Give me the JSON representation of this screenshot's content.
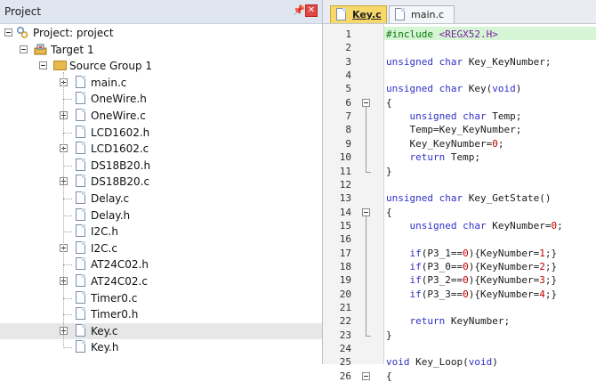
{
  "panel": {
    "title": "Project"
  },
  "tree": [
    {
      "label": "Project: project",
      "type": "project",
      "expander": "minus"
    },
    {
      "label": "Target 1",
      "type": "target",
      "expander": "minus"
    },
    {
      "label": "Source Group 1",
      "type": "folder",
      "expander": "minus"
    },
    {
      "label": "main.c",
      "type": "file",
      "expander": "plus"
    },
    {
      "label": "OneWire.h",
      "type": "file",
      "expander": ""
    },
    {
      "label": "OneWire.c",
      "type": "file",
      "expander": "plus"
    },
    {
      "label": "LCD1602.h",
      "type": "file",
      "expander": ""
    },
    {
      "label": "LCD1602.c",
      "type": "file",
      "expander": "plus"
    },
    {
      "label": "DS18B20.h",
      "type": "file",
      "expander": ""
    },
    {
      "label": "DS18B20.c",
      "type": "file",
      "expander": "plus"
    },
    {
      "label": "Delay.c",
      "type": "file",
      "expander": ""
    },
    {
      "label": "Delay.h",
      "type": "file",
      "expander": ""
    },
    {
      "label": "I2C.h",
      "type": "file",
      "expander": ""
    },
    {
      "label": "I2C.c",
      "type": "file",
      "expander": "plus"
    },
    {
      "label": "AT24C02.h",
      "type": "file",
      "expander": ""
    },
    {
      "label": "AT24C02.c",
      "type": "file",
      "expander": "plus"
    },
    {
      "label": "Timer0.c",
      "type": "file",
      "expander": ""
    },
    {
      "label": "Timer0.h",
      "type": "file",
      "expander": ""
    },
    {
      "label": "Key.c",
      "type": "file",
      "expander": "plus",
      "selected": true
    },
    {
      "label": "Key.h",
      "type": "file",
      "expander": ""
    }
  ],
  "tabs": [
    {
      "label": "Key.c",
      "active": true
    },
    {
      "label": "main.c",
      "active": false
    }
  ],
  "code": [
    {
      "n": "1",
      "text": "#include <REGX52.H>",
      "highlight": true
    },
    {
      "n": "2",
      "text": ""
    },
    {
      "n": "3",
      "text": "unsigned char Key_KeyNumber;"
    },
    {
      "n": "4",
      "text": ""
    },
    {
      "n": "5",
      "text": "unsigned char Key(void)"
    },
    {
      "n": "6",
      "text": "{"
    },
    {
      "n": "7",
      "text": "    unsigned char Temp;"
    },
    {
      "n": "8",
      "text": "    Temp=Key_KeyNumber;"
    },
    {
      "n": "9",
      "text": "    Key_KeyNumber=0;"
    },
    {
      "n": "10",
      "text": "    return Temp;"
    },
    {
      "n": "11",
      "text": "}"
    },
    {
      "n": "12",
      "text": ""
    },
    {
      "n": "13",
      "text": "unsigned char Key_GetState()"
    },
    {
      "n": "14",
      "text": "{"
    },
    {
      "n": "15",
      "text": "    unsigned char KeyNumber=0;"
    },
    {
      "n": "16",
      "text": ""
    },
    {
      "n": "17",
      "text": "    if(P3_1==0){KeyNumber=1;}"
    },
    {
      "n": "18",
      "text": "    if(P3_0==0){KeyNumber=2;}"
    },
    {
      "n": "19",
      "text": "    if(P3_2==0){KeyNumber=3;}"
    },
    {
      "n": "20",
      "text": "    if(P3_3==0){KeyNumber=4;}"
    },
    {
      "n": "21",
      "text": ""
    },
    {
      "n": "22",
      "text": "    return KeyNumber;"
    },
    {
      "n": "23",
      "text": "}"
    },
    {
      "n": "24",
      "text": ""
    },
    {
      "n": "25",
      "text": "void Key_Loop(void)"
    },
    {
      "n": "26",
      "text": "{"
    }
  ],
  "colors": {
    "keyword": "#3030c8",
    "preprocessor": "#0a7a0a",
    "string": "#7a1fa0",
    "number": "#c00000",
    "text": "#1a1a1a",
    "active_tab": "#f6d86b",
    "highlight_line": "#d5f5d5"
  }
}
